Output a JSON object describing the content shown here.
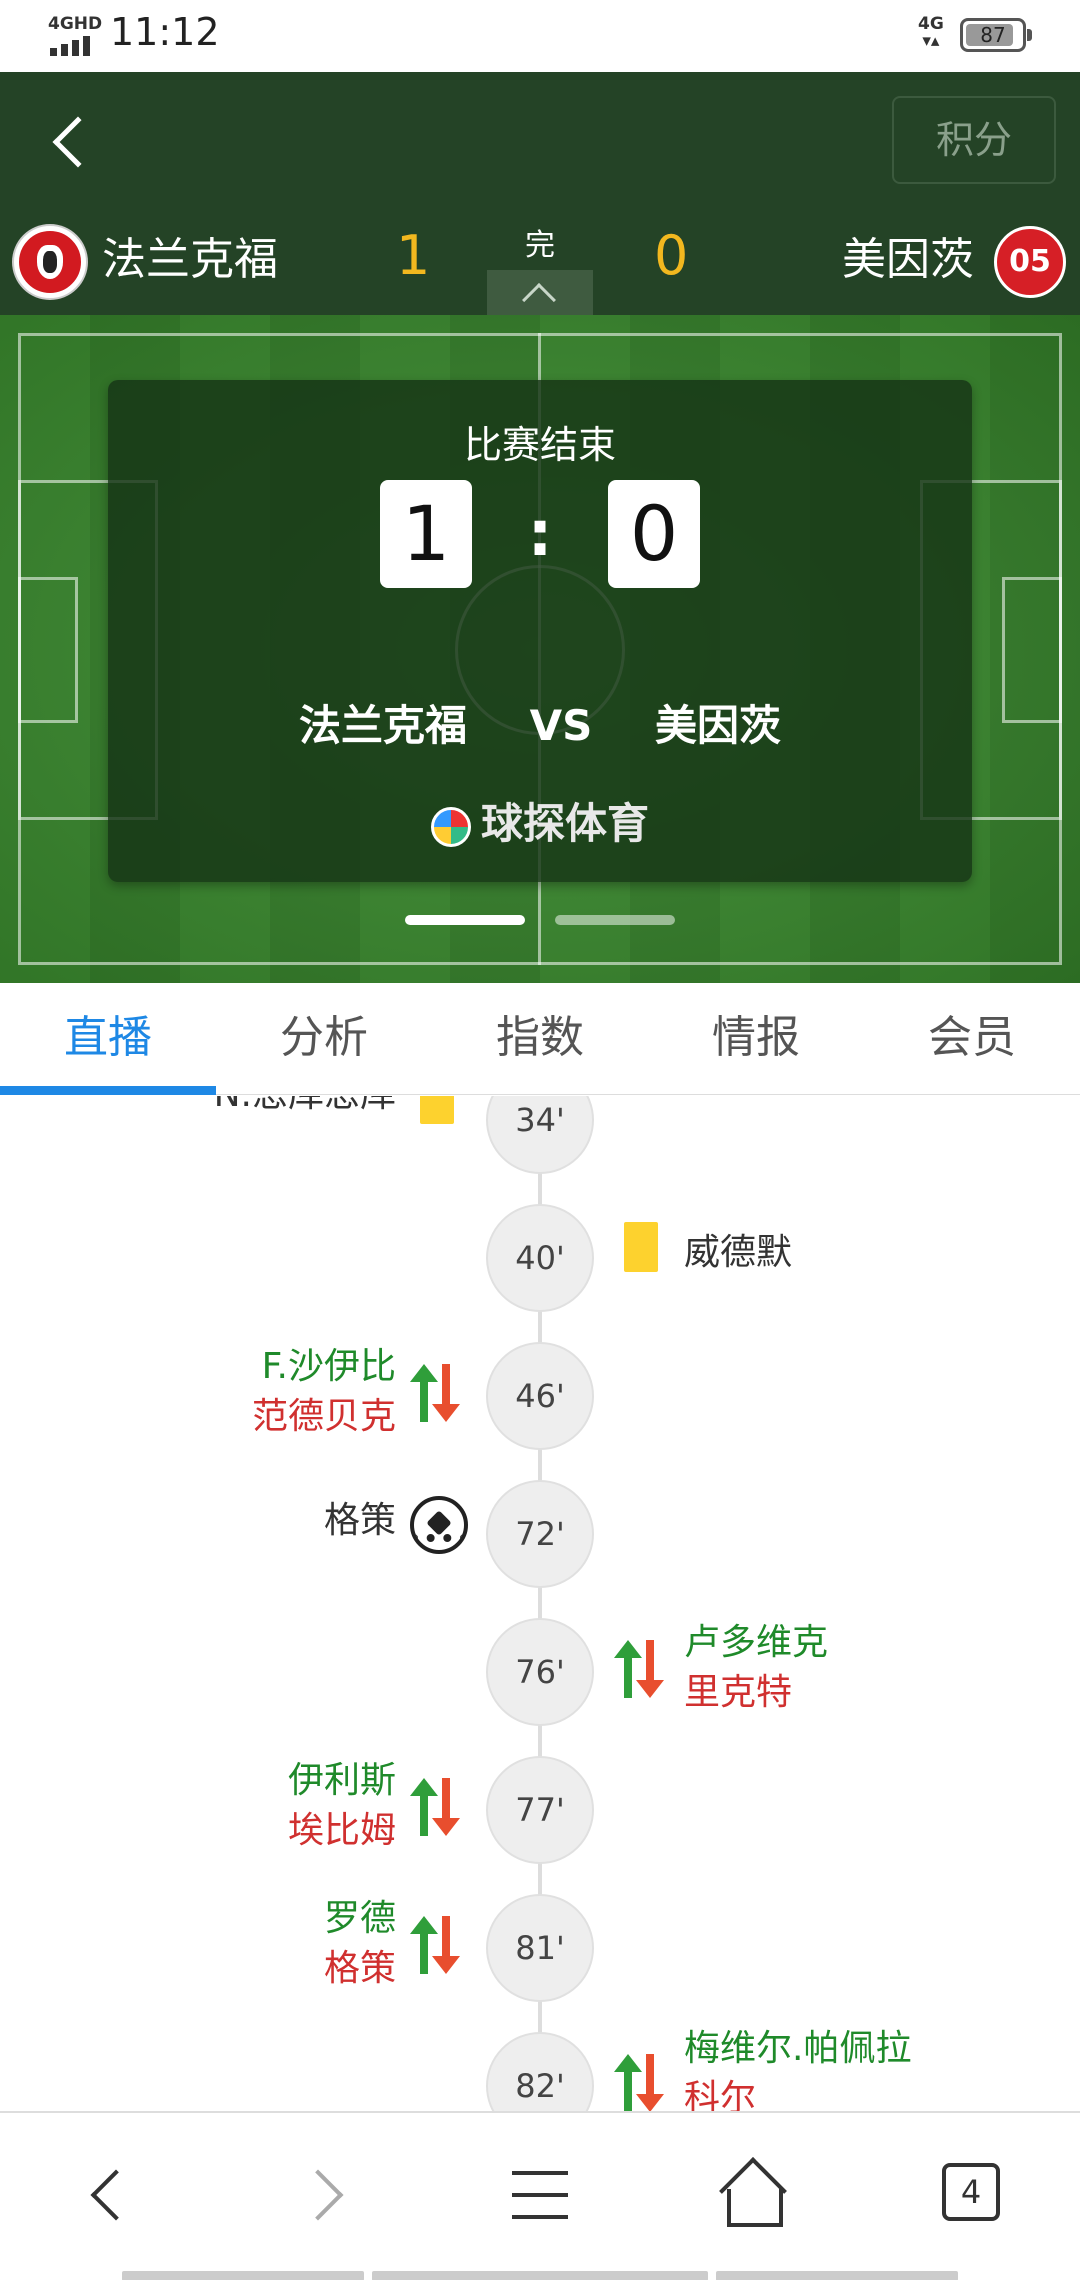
{
  "status_bar": {
    "network_type": "4GHD",
    "time": "11:12",
    "cell_type": "4G",
    "battery_level": "87"
  },
  "header": {
    "standings_label": "积分",
    "home_team": "法兰克福",
    "away_team": "美因茨",
    "home_score": "1",
    "away_score": "0",
    "status": "完",
    "away_logo_text": "05"
  },
  "scoreboard": {
    "title": "比赛结束",
    "home_score": "1",
    "separator": ":",
    "away_score": "0",
    "home_team": "法兰克福",
    "vs": "VS",
    "away_team": "美因茨",
    "brand": "球探体育",
    "page_indicator": {
      "total": 2,
      "active": 1
    }
  },
  "tabs": [
    {
      "label": "直播",
      "active": true
    },
    {
      "label": "分析",
      "active": false
    },
    {
      "label": "指数",
      "active": false
    },
    {
      "label": "情报",
      "active": false
    },
    {
      "label": "会员",
      "active": false
    }
  ],
  "timeline": [
    {
      "minute": "34'",
      "side": "home",
      "type": "yellow-card",
      "player": "N.恩库恩库"
    },
    {
      "minute": "40'",
      "side": "away",
      "type": "yellow-card",
      "player": "威德默"
    },
    {
      "minute": "46'",
      "side": "home",
      "type": "substitution",
      "player_in": "F.沙伊比",
      "player_out": "范德贝克"
    },
    {
      "minute": "72'",
      "side": "home",
      "type": "goal",
      "player": "格策"
    },
    {
      "minute": "76'",
      "side": "away",
      "type": "substitution",
      "player_in": "卢多维克",
      "player_out": "里克特"
    },
    {
      "minute": "77'",
      "side": "home",
      "type": "substitution",
      "player_in": "伊利斯",
      "player_out": "埃比姆"
    },
    {
      "minute": "81'",
      "side": "home",
      "type": "substitution",
      "player_in": "罗德",
      "player_out": "格策"
    },
    {
      "minute": "82'",
      "side": "away",
      "type": "substitution",
      "player_in": "梅维尔.帕佩拉",
      "player_out": "科尔"
    }
  ],
  "bottom_nav": {
    "tab_count": "4"
  },
  "colors": {
    "header_bg": "#244326",
    "score_yellow": "#f2b81f",
    "tab_active": "#1e88e5",
    "sub_in": "#1f8a2a",
    "sub_out": "#d0302f",
    "yellow_card": "#fdd22e"
  }
}
